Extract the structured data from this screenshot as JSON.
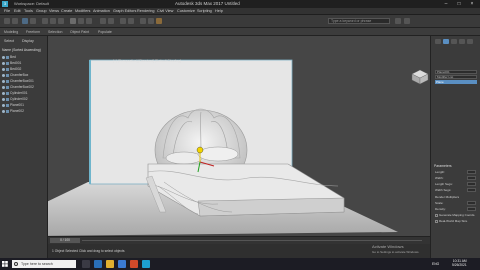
{
  "window": {
    "title": "Autodesk 3ds Max 2017   Untitled",
    "doc_tab": "Workspace: Default"
  },
  "menubar": {
    "items": [
      "File",
      "Edit",
      "Tools",
      "Group",
      "Views",
      "Create",
      "Modifiers",
      "Animation",
      "Graph Editors",
      "Rendering",
      "Civil View",
      "Customize",
      "Scripting",
      "Help"
    ]
  },
  "toolbar": {
    "search_placeholder": "Type a keyword or phrase"
  },
  "ribbon": {
    "items": [
      "Modeling",
      "Freeform",
      "Selection",
      "Object Paint",
      "Populate"
    ]
  },
  "scene_explorer": {
    "tabs": [
      "Select",
      "Display"
    ],
    "header": "Name (Sorted Ascending)",
    "items": [
      "Bed",
      "Bed001",
      "Bed002",
      "ChamferBox",
      "ChamferBox001",
      "ChamferBox002",
      "Cylinder001",
      "Cylinder002",
      "Plane001",
      "Plane002"
    ]
  },
  "viewport": {
    "label": "[+] [Perspective] [Standard] [Default Shading]"
  },
  "command_panel": {
    "field1": "Plane001",
    "field2": "Modifier List",
    "selected": "Plane",
    "params_title": "Parameters",
    "params": [
      {
        "label": "Length:",
        "type": "spinner"
      },
      {
        "label": "Width:",
        "type": "spinner"
      },
      {
        "label": "Length Segs:",
        "type": "spinner"
      },
      {
        "label": "Width Segs:",
        "type": "spinner"
      },
      {
        "label": "Render Multipliers",
        "type": "header"
      },
      {
        "label": "Scale:",
        "type": "spinner"
      },
      {
        "label": "Density:",
        "type": "spinner"
      },
      {
        "label": "Generate Mapping Coords.",
        "type": "check"
      },
      {
        "label": "Real-World Map Size",
        "type": "check"
      }
    ]
  },
  "timeline": {
    "frame": "0 / 100"
  },
  "status": {
    "message": "1 Object Selected   Click and drag to select objects",
    "activate": "Activate Windows",
    "activate_sub": "Go to Settings to activate Windows."
  },
  "taskbar": {
    "search": "Type here to search",
    "lang": "ENG",
    "time": "10:31 AM",
    "date": "5/26/2021"
  },
  "colors": {
    "accent": "#5a8fc2",
    "viewport_bg": "#464646",
    "panel": "#3b3b3b"
  }
}
